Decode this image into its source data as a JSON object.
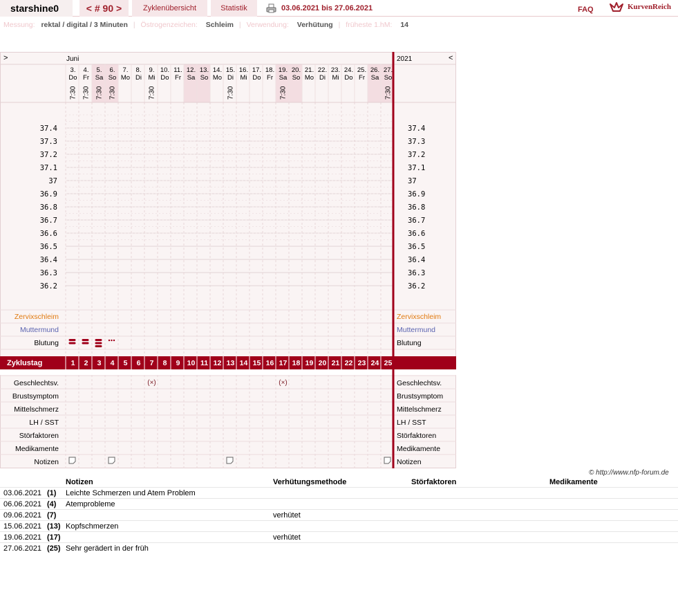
{
  "header": {
    "username": "starshine0",
    "cycle_label": "< # 90 >",
    "nav_overview": "Zyklenübersicht",
    "nav_stats": "Statistik",
    "date_range": "03.06.2021 bis 27.06.2021",
    "faq": "FAQ",
    "logo_text": "KurvenReich"
  },
  "info": {
    "measure_label": "Messung:",
    "measure_value": "rektal / digital / 3 Minuten",
    "estrogen_label": "Östrogenzeichen:",
    "estrogen_value": "Schleim",
    "usage_label": "Verwendung:",
    "usage_value": "Verhütung",
    "earliest_label": "früheste 1.hM:",
    "earliest_value": "14"
  },
  "chart": {
    "nav_prev": ">",
    "nav_next": "<",
    "month": "Juni",
    "year": "2021",
    "days": [
      {
        "num": "3.",
        "wd": "Do",
        "time": "7:30",
        "weekend": false
      },
      {
        "num": "4.",
        "wd": "Fr",
        "time": "7:30",
        "weekend": false
      },
      {
        "num": "5.",
        "wd": "Sa",
        "time": "7:30",
        "weekend": true
      },
      {
        "num": "6.",
        "wd": "So",
        "time": "7:30",
        "weekend": true
      },
      {
        "num": "7.",
        "wd": "Mo",
        "time": "",
        "weekend": false
      },
      {
        "num": "8.",
        "wd": "Di",
        "time": "",
        "weekend": false
      },
      {
        "num": "9.",
        "wd": "Mi",
        "time": "7:30",
        "weekend": false
      },
      {
        "num": "10.",
        "wd": "Do",
        "time": "",
        "weekend": false
      },
      {
        "num": "11.",
        "wd": "Fr",
        "time": "",
        "weekend": false
      },
      {
        "num": "12.",
        "wd": "Sa",
        "time": "",
        "weekend": true
      },
      {
        "num": "13.",
        "wd": "So",
        "time": "",
        "weekend": true
      },
      {
        "num": "14.",
        "wd": "Mo",
        "time": "",
        "weekend": false
      },
      {
        "num": "15.",
        "wd": "Di",
        "time": "7:30",
        "weekend": false
      },
      {
        "num": "16.",
        "wd": "Mi",
        "time": "",
        "weekend": false
      },
      {
        "num": "17.",
        "wd": "Do",
        "time": "",
        "weekend": false
      },
      {
        "num": "18.",
        "wd": "Fr",
        "time": "",
        "weekend": false
      },
      {
        "num": "19.",
        "wd": "Sa",
        "time": "7:30",
        "weekend": true
      },
      {
        "num": "20.",
        "wd": "So",
        "time": "",
        "weekend": true
      },
      {
        "num": "21.",
        "wd": "Mo",
        "time": "",
        "weekend": false
      },
      {
        "num": "22.",
        "wd": "Di",
        "time": "",
        "weekend": false
      },
      {
        "num": "23.",
        "wd": "Mi",
        "time": "",
        "weekend": false
      },
      {
        "num": "24.",
        "wd": "Do",
        "time": "",
        "weekend": false
      },
      {
        "num": "25.",
        "wd": "Fr",
        "time": "",
        "weekend": false
      },
      {
        "num": "26.",
        "wd": "Sa",
        "time": "",
        "weekend": true
      },
      {
        "num": "27.",
        "wd": "So",
        "time": "7:30",
        "weekend": true
      }
    ],
    "temps": [
      "37.4",
      "37.3",
      "37.2",
      "37.1",
      "37",
      "36.9",
      "36.8",
      "36.7",
      "36.6",
      "36.5",
      "36.4",
      "36.3",
      "36.2"
    ],
    "row_cervix": "Zervixschleim",
    "row_cervix_color": "#e07a10",
    "row_muttermund": "Muttermund",
    "row_muttermund_color": "#5a63b0",
    "row_bleeding": "Blutung",
    "bleeding": [
      3,
      3,
      3,
      1,
      0,
      0,
      0,
      0,
      0,
      0,
      0,
      0,
      0,
      0,
      0,
      0,
      0,
      0,
      0,
      0,
      0,
      0,
      0,
      0,
      0
    ],
    "cycle_label": "Zyklustag",
    "cycle_days": [
      "1",
      "2",
      "3",
      "4",
      "5",
      "6",
      "7",
      "8",
      "9",
      "10",
      "11",
      "12",
      "13",
      "14",
      "15",
      "16",
      "17",
      "18",
      "19",
      "20",
      "21",
      "22",
      "23",
      "24",
      "25"
    ],
    "row_sex": "Geschlechtsv.",
    "sex_mark": "(×)",
    "sex_days": [
      7,
      17
    ],
    "row_breast": "Brustsymptom",
    "row_midpain": "Mittelschmerz",
    "row_lh": "LH / SST",
    "row_disturb": "Störfaktoren",
    "row_meds": "Medikamente",
    "row_notes": "Notizen",
    "note_days": [
      1,
      4,
      13,
      25
    ],
    "accent": "#a0001a"
  },
  "notes_table": {
    "copyright": "© http://www.nfp-forum.de",
    "head_notes": "Notizen",
    "head_method": "Verhütungsmethode",
    "head_disturb": "Störfaktoren",
    "head_meds": "Medikamente",
    "rows": [
      {
        "date": "03.06.2021",
        "day": "(1)",
        "note": "Leichte Schmerzen und Atem Problem",
        "method": ""
      },
      {
        "date": "06.06.2021",
        "day": "(4)",
        "note": "Atemprobleme",
        "method": ""
      },
      {
        "date": "09.06.2021",
        "day": "(7)",
        "note": "",
        "method": "verhütet"
      },
      {
        "date": "15.06.2021",
        "day": "(13)",
        "note": "Kopfschmerzen",
        "method": ""
      },
      {
        "date": "19.06.2021",
        "day": "(17)",
        "note": "",
        "method": "verhütet"
      },
      {
        "date": "27.06.2021",
        "day": "(25)",
        "note": "Sehr gerädert in der früh",
        "method": ""
      }
    ]
  }
}
